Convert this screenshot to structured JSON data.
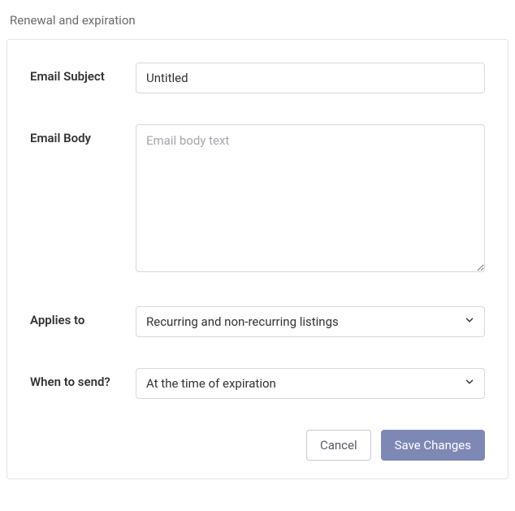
{
  "section_title": "Renewal and expiration",
  "form": {
    "email_subject": {
      "label": "Email Subject",
      "value": "Untitled"
    },
    "email_body": {
      "label": "Email Body",
      "placeholder": "Email body text",
      "value": ""
    },
    "applies_to": {
      "label": "Applies to",
      "selected": "Recurring and non-recurring listings"
    },
    "when_to_send": {
      "label": "When to send?",
      "selected": "At the time of expiration"
    }
  },
  "buttons": {
    "cancel": "Cancel",
    "save": "Save Changes"
  }
}
